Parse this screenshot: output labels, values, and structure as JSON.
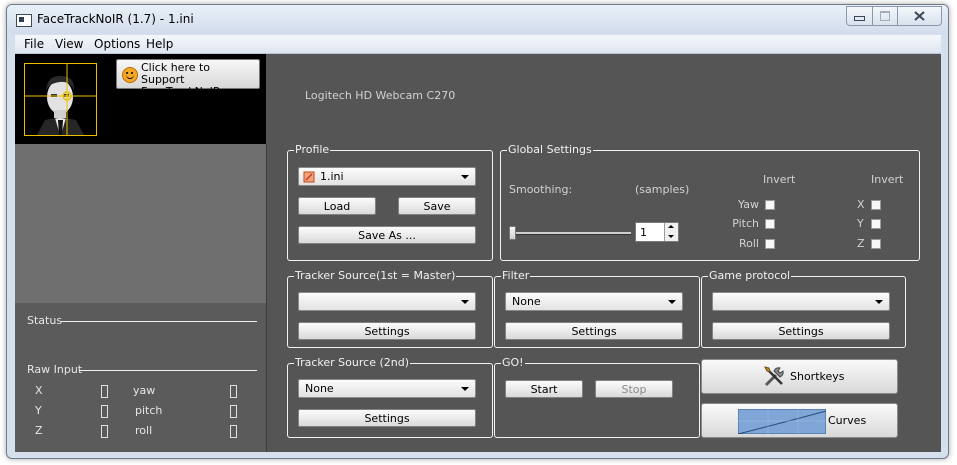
{
  "window": {
    "title": "FaceTrackNoIR (1.7) - 1.ini",
    "controls": {
      "minimize": "minimize-icon",
      "maximize": "maximize-icon",
      "close": "close-icon"
    }
  },
  "menu": {
    "items": [
      "File",
      "View",
      "Options",
      "Help"
    ]
  },
  "support": {
    "line1": "Click here to",
    "line2": "Support FaceTrackNoIR"
  },
  "camera": {
    "name": "Logitech HD Webcam C270"
  },
  "left": {
    "status_label": "Status",
    "raw_input_label": "Raw Input",
    "axes": [
      {
        "name": "X",
        "value": ""
      },
      {
        "name": "Y",
        "value": ""
      },
      {
        "name": "Z",
        "value": ""
      }
    ],
    "rotations": [
      {
        "name": "yaw",
        "value": ""
      },
      {
        "name": "pitch",
        "value": ""
      },
      {
        "name": "roll",
        "value": ""
      }
    ]
  },
  "profile": {
    "label": "Profile",
    "selected": "1.ini",
    "load": "Load",
    "save": "Save",
    "save_as": "Save As ..."
  },
  "global_settings": {
    "label": "Global Settings",
    "smoothing_label": "Smoothing:",
    "samples_label": "(samples)",
    "smoothing_value": "1",
    "smoothing_level": 0,
    "invert_heading": "Invert",
    "rotation_inverts": [
      {
        "label": "Yaw",
        "checked": false
      },
      {
        "label": "Pitch",
        "checked": false
      },
      {
        "label": "Roll",
        "checked": false
      }
    ],
    "position_inverts": [
      {
        "label": "X",
        "checked": false
      },
      {
        "label": "Y",
        "checked": false
      },
      {
        "label": "Z",
        "checked": false
      }
    ]
  },
  "tracker_source_1": {
    "label": "Tracker Source(1st = Master)",
    "selected": "",
    "settings": "Settings"
  },
  "filter": {
    "label": "Filter",
    "selected": "None",
    "settings": "Settings"
  },
  "game_protocol": {
    "label": "Game protocol",
    "selected": "",
    "settings": "Settings"
  },
  "tracker_source_2": {
    "label": "Tracker Source (2nd)",
    "selected": "None",
    "settings": "Settings"
  },
  "go": {
    "label": "GO!",
    "start": "Start",
    "stop": "Stop"
  },
  "shortkeys": {
    "label": "Shortkeys",
    "icon": "tools-icon"
  },
  "curves": {
    "label": "Curves",
    "icon": "curve-preview-icon"
  },
  "colors": {
    "panel": "#555555",
    "face_frame": "#e8c000",
    "titlebar": "#d6e0ec"
  }
}
